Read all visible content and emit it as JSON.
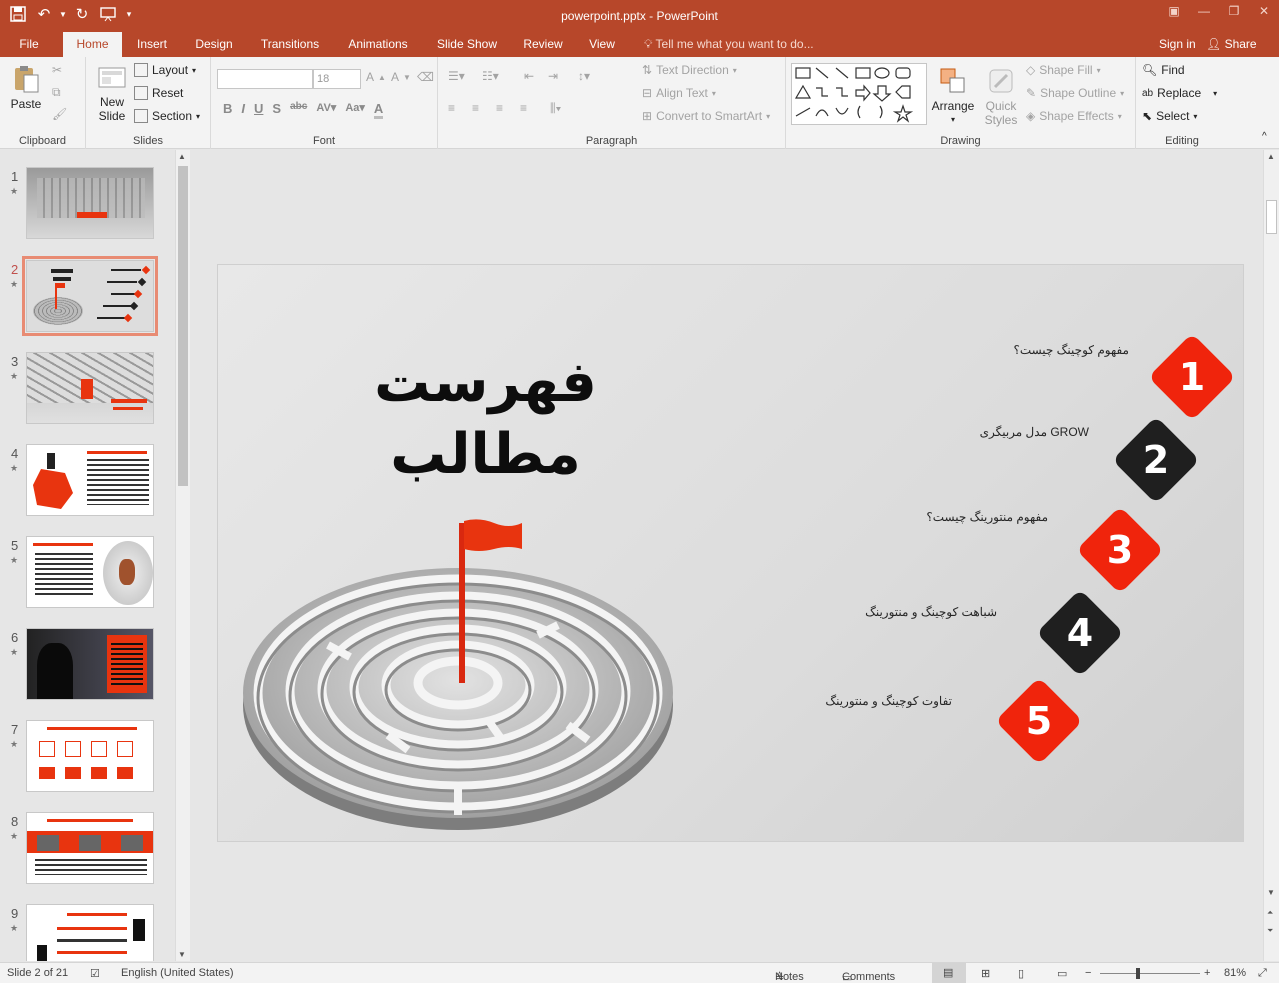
{
  "app": {
    "window_title": "powerpoint.pptx - PowerPoint",
    "accent": "#b7472a"
  },
  "tabs": [
    {
      "label": "File"
    },
    {
      "label": "Home"
    },
    {
      "label": "Insert"
    },
    {
      "label": "Design"
    },
    {
      "label": "Transitions"
    },
    {
      "label": "Animations"
    },
    {
      "label": "Slide Show"
    },
    {
      "label": "Review"
    },
    {
      "label": "View"
    }
  ],
  "tell_me": "Tell me what you want to do...",
  "sign_in": "Sign in",
  "share": "Share",
  "ribbon": {
    "clipboard": {
      "label": "Clipboard",
      "paste": "Paste"
    },
    "slides": {
      "label": "Slides",
      "new_slide": "New",
      "new_slide2": "Slide",
      "layout": "Layout",
      "reset": "Reset",
      "section": "Section"
    },
    "font": {
      "label": "Font",
      "font_name": "",
      "font_size": "18"
    },
    "paragraph": {
      "label": "Paragraph",
      "text_direction": "Text Direction",
      "align_text": "Align Text",
      "convert_smartart": "Convert to SmartArt"
    },
    "drawing": {
      "label": "Drawing",
      "arrange": "Arrange",
      "quick_styles": "Quick",
      "quick_styles2": "Styles",
      "shape_fill": "Shape Fill",
      "shape_outline": "Shape Outline",
      "shape_effects": "Shape Effects"
    },
    "editing": {
      "label": "Editing",
      "find": "Find",
      "replace": "Replace",
      "select": "Select"
    }
  },
  "thumbnails": [
    {
      "num": "1"
    },
    {
      "num": "2"
    },
    {
      "num": "3"
    },
    {
      "num": "4"
    },
    {
      "num": "5"
    },
    {
      "num": "6"
    },
    {
      "num": "7"
    },
    {
      "num": "8"
    },
    {
      "num": "9"
    }
  ],
  "slide": {
    "title_line1": "فهرست",
    "title_line2": "مطالب",
    "items": [
      {
        "num": "1",
        "text": "مفهوم کوچینگ چیست؟",
        "color": "#f0240c"
      },
      {
        "num": "2",
        "text": "مدل مربیگری GROW",
        "color": "#1f1f1f"
      },
      {
        "num": "3",
        "text": "مفهوم منتورینگ چیست؟",
        "color": "#f0240c"
      },
      {
        "num": "4",
        "text": "شباهت کوچینگ و منتورینگ",
        "color": "#1f1f1f"
      },
      {
        "num": "5",
        "text": "تفاوت کوچینگ و منتورینگ",
        "color": "#f0240c"
      }
    ]
  },
  "status": {
    "slide_info": "Slide 2 of 21",
    "language": "English (United States)",
    "notes": "Notes",
    "comments": "Comments",
    "zoom": "81%"
  }
}
